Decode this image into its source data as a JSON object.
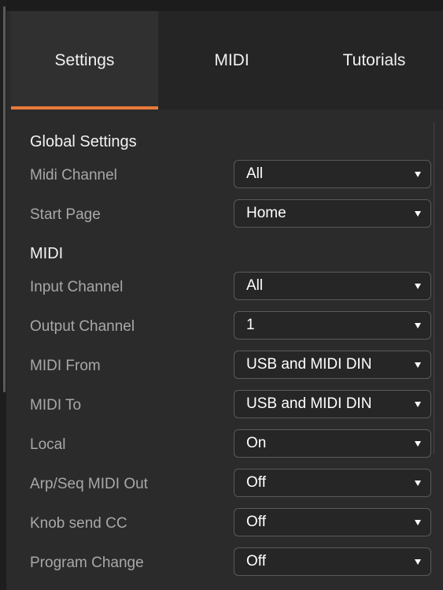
{
  "tabs": [
    {
      "label": "Settings",
      "active": true
    },
    {
      "label": "MIDI",
      "active": false
    },
    {
      "label": "Tutorials",
      "active": false
    }
  ],
  "colors": {
    "accent": "#e97a3b",
    "background": "#2b2b2b",
    "label": "#a8a8a8"
  },
  "sections": {
    "global": {
      "title": "Global Settings",
      "rows": [
        {
          "label": "Midi Channel",
          "value": "All"
        },
        {
          "label": "Start Page",
          "value": "Home"
        }
      ]
    },
    "midi": {
      "title": "MIDI",
      "rows": [
        {
          "label": "Input Channel",
          "value": "All"
        },
        {
          "label": "Output Channel",
          "value": "1"
        },
        {
          "label": "MIDI From",
          "value": "USB and MIDI DIN"
        },
        {
          "label": "MIDI To",
          "value": "USB and MIDI DIN"
        },
        {
          "label": "Local",
          "value": "On"
        },
        {
          "label": "Arp/Seq MIDI Out",
          "value": "Off"
        },
        {
          "label": "Knob send CC",
          "value": "Off"
        },
        {
          "label": "Program Change",
          "value": "Off"
        }
      ]
    }
  },
  "icons": {
    "dropdown": "caret-down-icon"
  }
}
